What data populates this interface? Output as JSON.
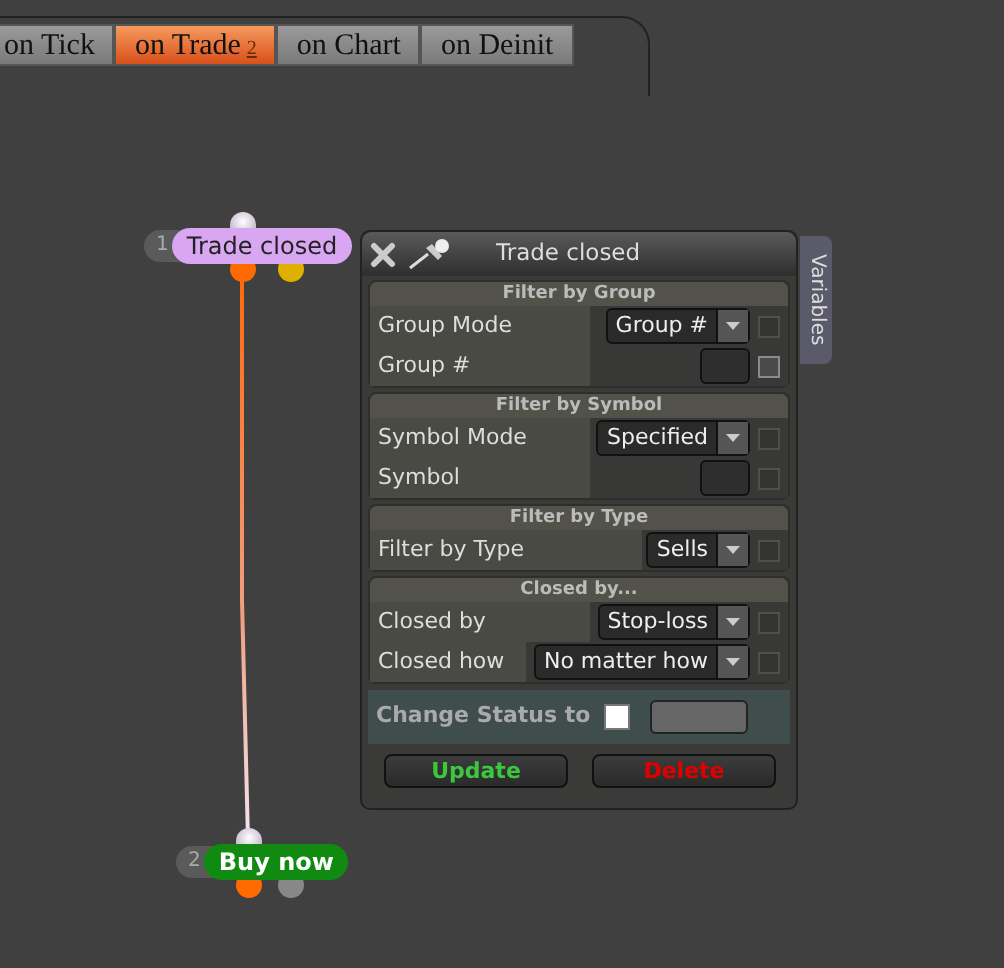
{
  "tabs": [
    {
      "label": "on Tick",
      "selected": false
    },
    {
      "label": "on Trade",
      "count": "2",
      "selected": true
    },
    {
      "label": "on Chart",
      "selected": false
    },
    {
      "label": "on Deinit",
      "selected": false
    }
  ],
  "nodes": [
    {
      "number": "1",
      "label": "Trade closed",
      "color": "#d9a6f2"
    },
    {
      "number": "2",
      "label": "Buy now",
      "color": "#108a10"
    }
  ],
  "panel": {
    "title": "Trade closed",
    "side_tab": "Variables",
    "sections": [
      {
        "title": "Filter by Group",
        "rows": [
          {
            "kind": "select",
            "label": "Group Mode",
            "value": "Group #",
            "disabled": true
          },
          {
            "kind": "input",
            "label": "Group #",
            "disabled": false
          }
        ]
      },
      {
        "title": "Filter by Symbol",
        "rows": [
          {
            "kind": "select",
            "label": "Symbol Mode",
            "value": "Specified",
            "disabled": true
          },
          {
            "kind": "input",
            "label": "Symbol",
            "disabled": true
          }
        ]
      },
      {
        "title": "Filter by Type",
        "rows": [
          {
            "kind": "select",
            "label": "Filter by Type",
            "value": "Sells",
            "disabled": true
          }
        ]
      },
      {
        "title": "Closed by...",
        "rows": [
          {
            "kind": "select",
            "label": "Closed by",
            "value": "Stop-loss",
            "disabled": true
          },
          {
            "kind": "select",
            "label": "Closed how",
            "value": "No matter how",
            "disabled": true
          }
        ]
      }
    ],
    "status": {
      "label": "Change Status to",
      "checked": false
    },
    "buttons": [
      {
        "label": "Update",
        "kind": "update"
      },
      {
        "label": "Delete",
        "kind": "delete"
      }
    ]
  }
}
